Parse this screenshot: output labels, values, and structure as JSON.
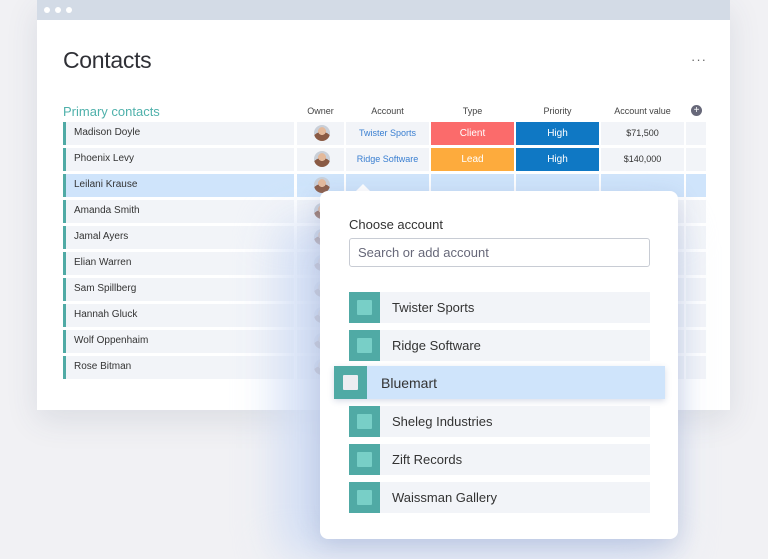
{
  "page": {
    "title": "Contacts",
    "more_label": "···"
  },
  "group": {
    "title": "Primary contacts"
  },
  "columns": {
    "owner": "Owner",
    "account": "Account",
    "type": "Type",
    "priority": "Priority",
    "value": "Account value",
    "add": "+"
  },
  "colors": {
    "client": "#fb6b6b",
    "lead": "#fdab3d",
    "high": "#0f78c4",
    "accent": "#50aaa5",
    "selected_row": "#cfe4fb"
  },
  "rows": [
    {
      "name": "Madison Doyle",
      "account": "Twister Sports",
      "type": "Client",
      "priority": "High",
      "value": "$71,500"
    },
    {
      "name": "Phoenix Levy",
      "account": "Ridge Software",
      "type": "Lead",
      "priority": "High",
      "value": "$140,000"
    },
    {
      "name": "Leilani Krause",
      "account": "",
      "type": "",
      "priority": "",
      "value": ""
    },
    {
      "name": "Amanda Smith"
    },
    {
      "name": "Jamal Ayers"
    },
    {
      "name": "Elian Warren"
    },
    {
      "name": "Sam Spillberg"
    },
    {
      "name": "Hannah Gluck"
    },
    {
      "name": "Wolf Oppenhaim"
    },
    {
      "name": "Rose Bitman"
    }
  ],
  "popup": {
    "title": "Choose account",
    "search_placeholder": "Search or add account",
    "options": [
      {
        "label": "Twister Sports"
      },
      {
        "label": "Ridge Software"
      },
      {
        "label": "Bluemart",
        "highlighted": true
      },
      {
        "label": "Sheleg Industries"
      },
      {
        "label": "Zift Records"
      },
      {
        "label": "Waissman Gallery"
      }
    ]
  }
}
